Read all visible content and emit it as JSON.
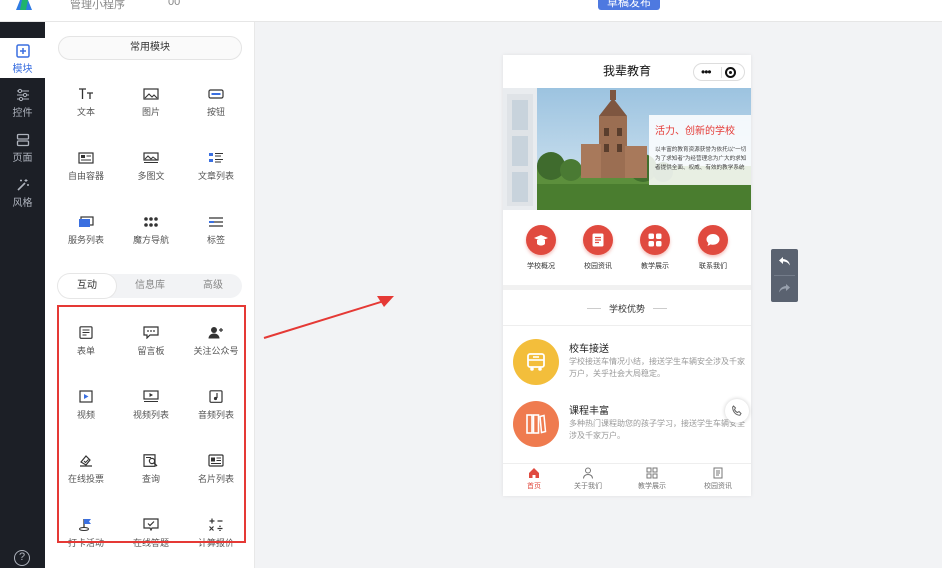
{
  "topbar": {
    "crumb": "管理小程序",
    "crumb2": "00",
    "publish_label": "草稿发布"
  },
  "rail": {
    "items": [
      {
        "label": "模块",
        "icon": "plus-square-icon"
      },
      {
        "label": "控件",
        "icon": "sliders-icon"
      },
      {
        "label": "页面",
        "icon": "pages-icon"
      },
      {
        "label": "风格",
        "icon": "magic-wand-icon"
      }
    ],
    "help": "?"
  },
  "panel": {
    "common_header": "常用模块",
    "common_modules": [
      {
        "label": "文本",
        "icon": "text-icon"
      },
      {
        "label": "图片",
        "icon": "image-icon"
      },
      {
        "label": "按钮",
        "icon": "button-icon"
      },
      {
        "label": "自由容器",
        "icon": "container-icon"
      },
      {
        "label": "多图文",
        "icon": "multi-image-icon"
      },
      {
        "label": "文章列表",
        "icon": "article-list-icon"
      },
      {
        "label": "服务列表",
        "icon": "service-list-icon"
      },
      {
        "label": "魔方导航",
        "icon": "cube-nav-icon"
      },
      {
        "label": "标签",
        "icon": "tag-icon"
      }
    ],
    "tabs": [
      "互动",
      "信息库",
      "高级"
    ],
    "interactive_modules": [
      {
        "label": "表单",
        "icon": "form-icon"
      },
      {
        "label": "留言板",
        "icon": "message-board-icon"
      },
      {
        "label": "关注公众号",
        "icon": "follow-icon"
      },
      {
        "label": "视频",
        "icon": "video-icon"
      },
      {
        "label": "视频列表",
        "icon": "video-list-icon"
      },
      {
        "label": "音频列表",
        "icon": "audio-list-icon"
      },
      {
        "label": "在线投票",
        "icon": "vote-icon"
      },
      {
        "label": "查询",
        "icon": "query-icon"
      },
      {
        "label": "名片列表",
        "icon": "card-list-icon"
      },
      {
        "label": "打卡活动",
        "icon": "checkin-icon"
      },
      {
        "label": "在线答题",
        "icon": "quiz-icon"
      },
      {
        "label": "计算报价",
        "icon": "calculator-icon"
      }
    ]
  },
  "preview": {
    "title": "我辈教育",
    "banner": {
      "headline": "活力、创新的学校",
      "text": "以丰富的教育资源获誉为依托以“一切为了求知者”为经营理念为广大的求知者提供全面、权威、有效的教学系统"
    },
    "quick_nav": [
      {
        "label": "学校概况",
        "icon": "graduation-cap-icon"
      },
      {
        "label": "校园资讯",
        "icon": "news-icon"
      },
      {
        "label": "教学展示",
        "icon": "grid-icon"
      },
      {
        "label": "联系我们",
        "icon": "chat-icon"
      }
    ],
    "section_title": "学校优势",
    "features": [
      {
        "title": "校车接送",
        "desc": "学校接送车情况小结，接送学生车辆安全涉及千家万户，关乎社会大局稳定。",
        "icon": "bus-icon",
        "color": "#f3be3b"
      },
      {
        "title": "课程丰富",
        "desc": "多种热门课程助您的孩子学习，接送学生车辆安全涉及千家万户。",
        "icon": "books-icon",
        "color": "#ef7b4f"
      }
    ],
    "tabbar": [
      {
        "label": "首页",
        "icon": "home-icon"
      },
      {
        "label": "关于我们",
        "icon": "user-icon"
      },
      {
        "label": "教学展示",
        "icon": "grid-outline-icon"
      },
      {
        "label": "校园资讯",
        "icon": "doc-icon"
      }
    ]
  }
}
